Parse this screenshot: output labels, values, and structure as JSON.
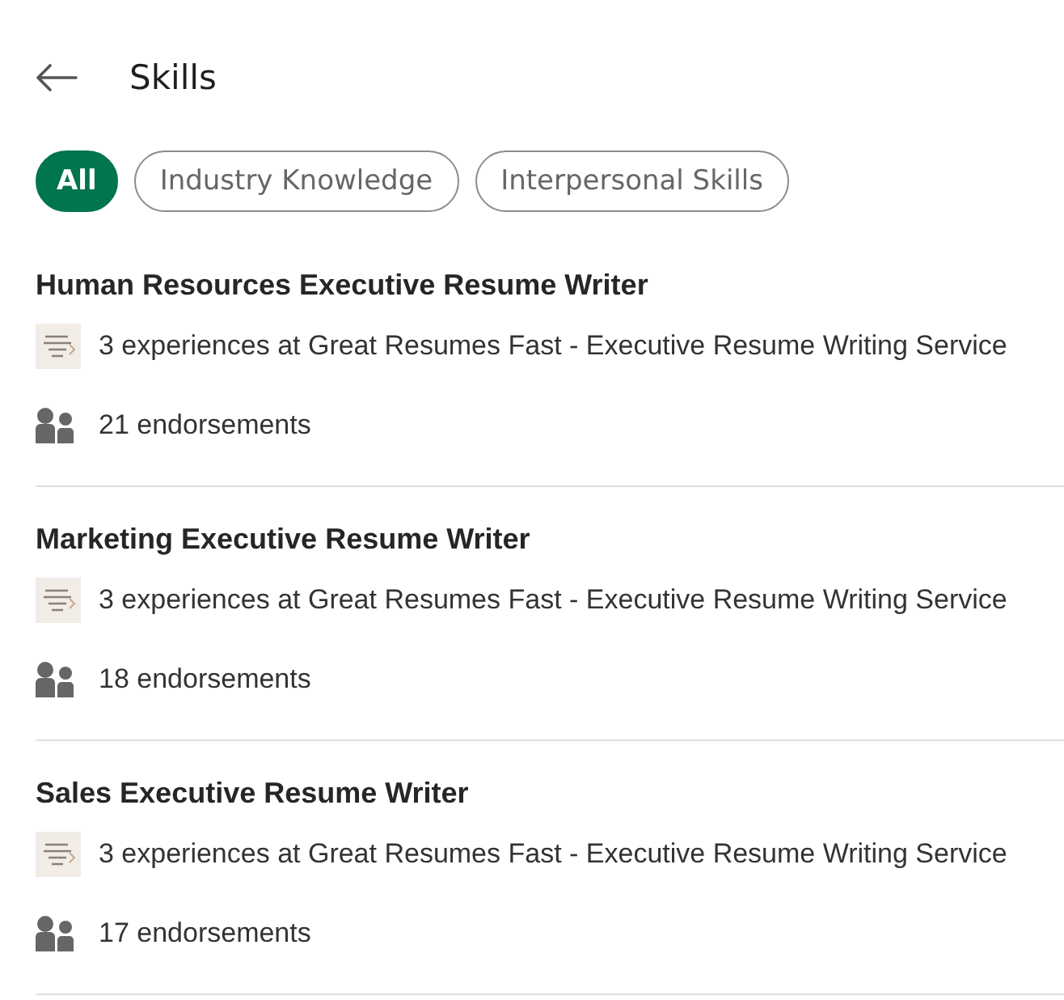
{
  "header": {
    "title": "Skills"
  },
  "filters": [
    {
      "label": "All",
      "selected": true
    },
    {
      "label": "Industry Knowledge",
      "selected": false
    },
    {
      "label": "Interpersonal Skills",
      "selected": false
    }
  ],
  "skills": [
    {
      "name": "Human Resources Executive Resume Writer",
      "experience": "3 experiences at Great Resumes Fast - Executive Resume Writing Service",
      "endorsements": "21 endorsements"
    },
    {
      "name": "Marketing Executive Resume Writer",
      "experience": "3 experiences at Great Resumes Fast - Executive Resume Writing Service",
      "endorsements": "18 endorsements"
    },
    {
      "name": "Sales Executive Resume Writer",
      "experience": "3 experiences at Great Resumes Fast - Executive Resume Writing Service",
      "endorsements": "17 endorsements"
    }
  ]
}
